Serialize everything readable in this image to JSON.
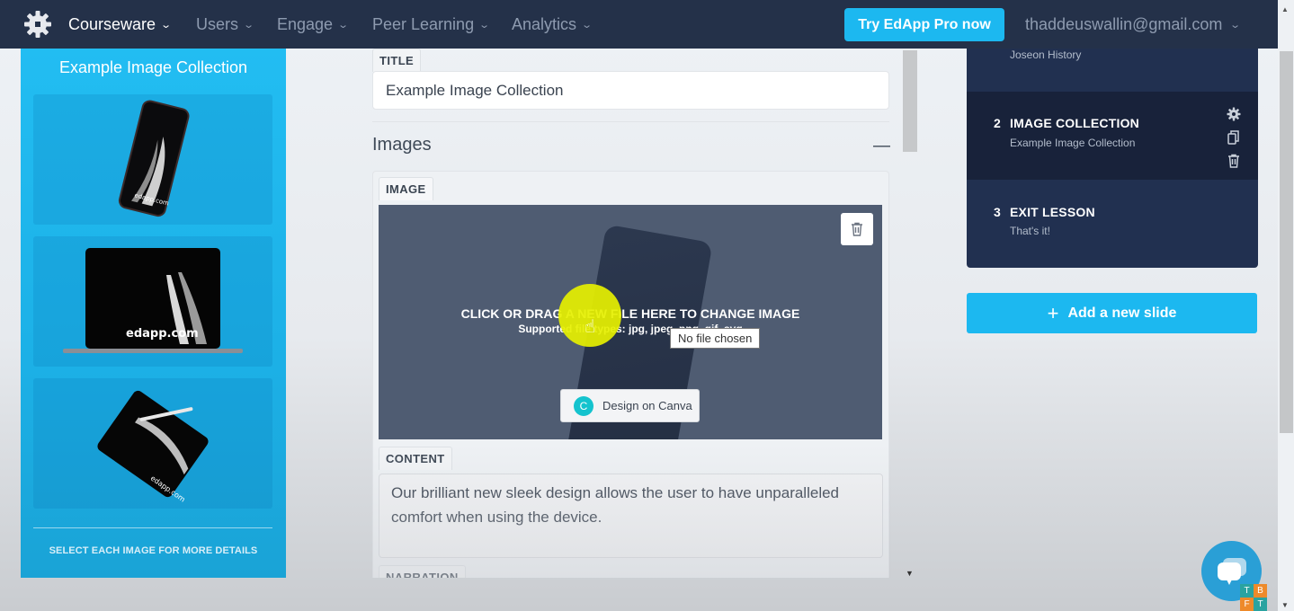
{
  "nav": {
    "logo": "gear-logo",
    "items": [
      {
        "label": "Courseware",
        "active": true
      },
      {
        "label": "Users",
        "active": false
      },
      {
        "label": "Engage",
        "active": false
      },
      {
        "label": "Peer Learning",
        "active": false
      },
      {
        "label": "Analytics",
        "active": false
      }
    ],
    "chevron": "⌄",
    "pro_button": "Try EdApp Pro now",
    "user_email": "thaddeuswallin@gmail.com"
  },
  "preview": {
    "title": "Example Image Collection",
    "images": [
      {
        "alt": "phone",
        "caption": "edapp.com"
      },
      {
        "alt": "laptop",
        "caption": "edapp.com"
      },
      {
        "alt": "tablet",
        "caption": "edapp.com"
      }
    ],
    "footer": "SELECT EACH IMAGE FOR MORE DETAILS"
  },
  "editor": {
    "title_label": "TITLE",
    "title_value": "Example Image Collection",
    "section_title": "Images",
    "collapse_symbol": "—",
    "image_label": "IMAGE",
    "dropzone_text": "CLICK OR DRAG A NEW FILE HERE TO CHANGE IMAGE",
    "dropzone_sub": "Supported file types: jpg, jpeg, png, gif, svg",
    "file_tooltip": "No file chosen",
    "canva_letter": "C",
    "canva_button": "Design on Canva",
    "content_label": "CONTENT",
    "content_value": "Our brilliant new sleek design allows the user to have unparalleled comfort when using the device.",
    "narration_label": "NARRATION"
  },
  "slides": [
    {
      "number": "",
      "type": "",
      "subtitle": "Joseon History",
      "active": false
    },
    {
      "number": "2",
      "type": "IMAGE COLLECTION",
      "subtitle": "Example Image Collection",
      "active": true
    },
    {
      "number": "3",
      "type": "EXIT LESSON",
      "subtitle": "That's it!",
      "active": false
    }
  ],
  "add_slide": {
    "icon": "+",
    "label": "Add a new slide"
  },
  "badges": [
    "T",
    "B",
    "F",
    "T"
  ],
  "colors": {
    "nav_bg": "#243149",
    "accent": "#1cb8f0",
    "slides_bg": "#213050",
    "slide_active": "#18223a"
  }
}
